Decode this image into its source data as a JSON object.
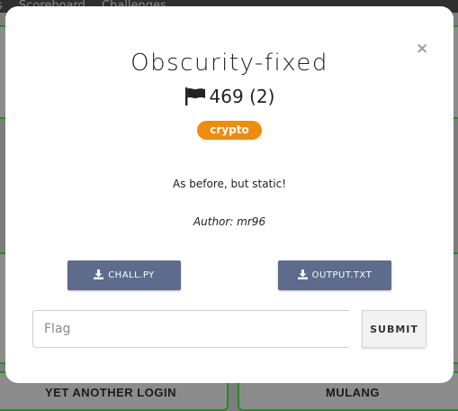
{
  "background": {
    "nav_items": [
      "s",
      "Scoreboard",
      "Challenges"
    ],
    "card_titles": [
      "YET ANOTHER LOGIN",
      "MULANG"
    ]
  },
  "modal": {
    "close_label": "×",
    "title": "Obscurity-fixed",
    "points": "469",
    "solves": "(2)",
    "category": "crypto",
    "description": "As before, but static!",
    "author": "Author: mr96",
    "files": [
      "CHALL.PY",
      "OUTPUT.TXT"
    ],
    "flag_placeholder": "Flag",
    "submit_label": "SUBMIT"
  },
  "colors": {
    "category_tag": "#f08c0c",
    "file_button": "#5d6b8c",
    "card_border": "#1f8f1f"
  }
}
